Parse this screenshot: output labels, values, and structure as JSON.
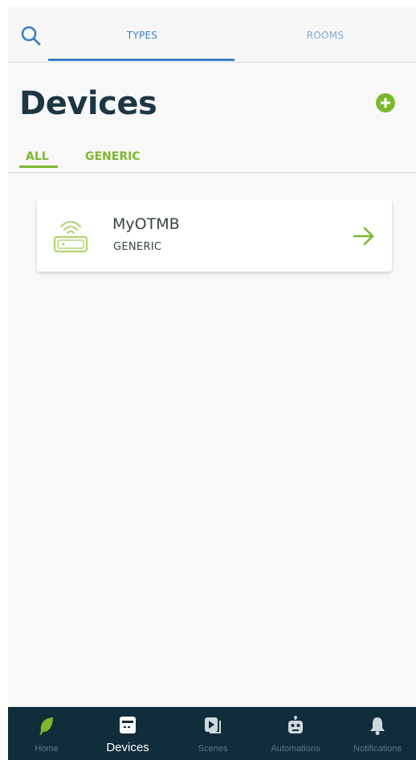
{
  "top_tabs": {
    "types_label": "TYPES",
    "rooms_label": "ROOMS",
    "active": "TYPES"
  },
  "page": {
    "title": "Devices"
  },
  "filters": {
    "all_label": "ALL",
    "generic_label": "GENERIC",
    "active": "ALL"
  },
  "devices": [
    {
      "name": "MyOTMB",
      "type": "GENERIC",
      "icon": "wifi-router-icon"
    }
  ],
  "bottom_nav": {
    "active": "Devices",
    "items": [
      {
        "label": "Home",
        "icon": "leaf-icon"
      },
      {
        "label": "Devices",
        "icon": "device-icon"
      },
      {
        "label": "Scenes",
        "icon": "scenes-icon"
      },
      {
        "label": "Automations",
        "icon": "robot-icon"
      },
      {
        "label": "Notifications",
        "icon": "bell-icon"
      }
    ]
  },
  "colors": {
    "accent_green": "#7cb82f",
    "accent_blue": "#3b7fc6",
    "nav_background": "#0f2d3b",
    "title_color": "#1c3645"
  }
}
